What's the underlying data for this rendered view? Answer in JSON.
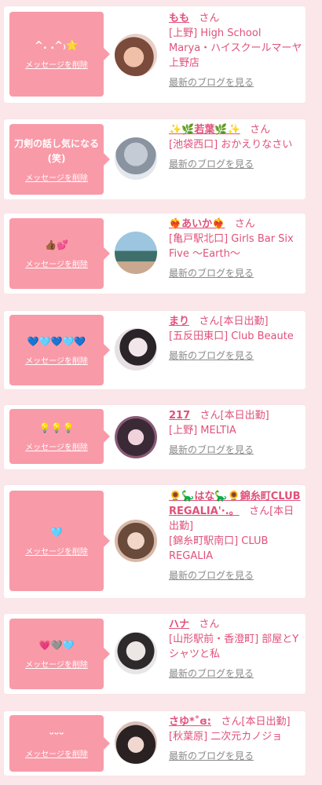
{
  "items": [
    {
      "message": "^. .^₎⭐",
      "delete": "メッセージを削除",
      "name": "もも",
      "san": "さん",
      "status": "",
      "shop": "[上野] High School Marya・ハイスクールマーヤ上野店",
      "blog": "最新のブログを見る",
      "avatar_color": "#e8b7a8"
    },
    {
      "message": "刀剣の話し気になる(笑)",
      "delete": "メッセージを削除",
      "name": "✨🌿若葉🌿✨",
      "san": "さん",
      "status": "",
      "shop": "[池袋西口] おかえりなさい",
      "blog": "最新のブログを見る",
      "avatar_color": "#c9cfd8"
    },
    {
      "message": "👍🏾💕",
      "delete": "メッセージを削除",
      "name": "❤️‍🔥あいか❤️‍🔥",
      "san": "さん",
      "status": "",
      "shop": "[亀戸駅北口] Girls Bar Six Five 〜Earth〜",
      "blog": "最新のブログを見る",
      "avatar_color": "#8fb3c9"
    },
    {
      "message": "💙🩵💙🩵💙",
      "delete": "メッセージを削除",
      "name": "まり",
      "san": "さん",
      "status": "[本日出勤]",
      "shop": "[五反田東口] Club Beaute",
      "blog": "最新のブログを見る",
      "avatar_color": "#d9d3da"
    },
    {
      "message": "💡💡💡",
      "delete": "メッセージを削除",
      "name": "217",
      "san": "さん",
      "status": "[本日出勤]",
      "shop": "[上野] MELTIA",
      "blog": "最新のブログを見る",
      "avatar_color": "#4a3a45"
    },
    {
      "message": "🩵",
      "delete": "メッセージを削除",
      "name": "🌻🦕はな🦕🌻錦糸町CLUB REGALIA'·.。",
      "san": "さん",
      "status": "[本日出勤]",
      "shop": "[錦糸町駅南口] CLUB REGALIA",
      "blog": "最新のブログを見る",
      "avatar_color": "#b08878"
    },
    {
      "message": "💗🩶🩵",
      "delete": "メッセージを削除",
      "name": "ハナ",
      "san": "さん",
      "status": "",
      "shop": "[山形駅前・香澄町] 部屋とYシャツと私",
      "blog": "最新のブログを見る",
      "avatar_color": "#d7d2d0"
    },
    {
      "message": "ᵕᵕᵕ",
      "delete": "メッセージを削除",
      "name": "さゆ*˚ɞ:",
      "san": "さん",
      "status": "[本日出勤]",
      "shop": "[秋葉原] 二次元カノジョ",
      "blog": "最新のブログを見る",
      "avatar_color": "#3a3030"
    }
  ]
}
